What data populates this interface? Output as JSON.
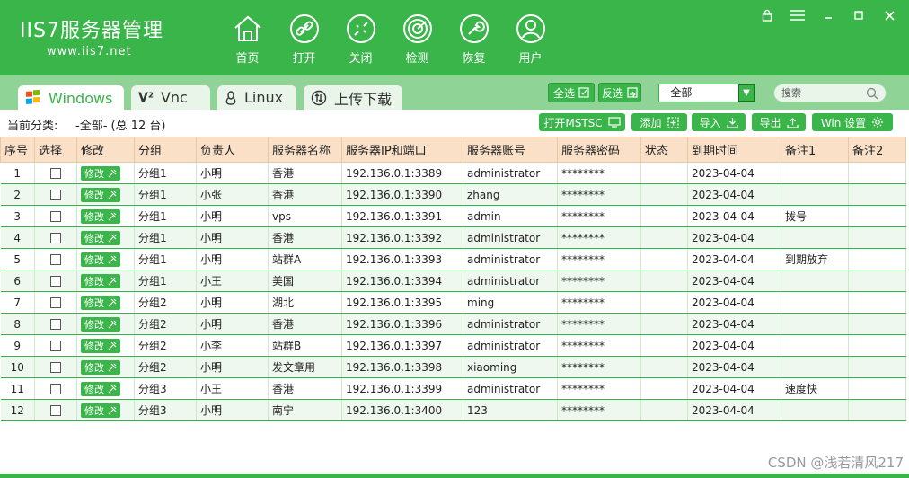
{
  "app": {
    "logo_title": "IIS7服务器管理",
    "logo_url": "www.iis7.net"
  },
  "nav": [
    {
      "label": "首页",
      "icon": "home-icon"
    },
    {
      "label": "打开",
      "icon": "link-icon"
    },
    {
      "label": "关闭",
      "icon": "unlink-icon"
    },
    {
      "label": "检测",
      "icon": "radar-icon"
    },
    {
      "label": "恢复",
      "icon": "wrench-icon"
    },
    {
      "label": "用户",
      "icon": "user-icon"
    }
  ],
  "tabs": [
    {
      "label": "Windows",
      "prefix": ""
    },
    {
      "label": "Vnc",
      "prefix": "V²"
    },
    {
      "label": "Linux",
      "prefix": ""
    },
    {
      "label": "上传下载",
      "prefix": ""
    }
  ],
  "tab_tools": {
    "select_all": "全选",
    "invert": "反选",
    "filter_value": "-全部-",
    "search_placeholder": "搜索"
  },
  "toolbar": {
    "category_label": "当前分类:",
    "category_value": "-全部- (总 12 台)",
    "open_mstsc": "打开MSTSC",
    "add": "添加",
    "import": "导入",
    "export": "导出",
    "win_settings": "Win 设置"
  },
  "table": {
    "headers": [
      "序号",
      "选择",
      "修改",
      "分组",
      "负责人",
      "服务器名称",
      "服务器IP和端口",
      "服务器账号",
      "服务器密码",
      "状态",
      "到期时间",
      "备注1",
      "备注2"
    ],
    "edit_label": "修改",
    "rows": [
      {
        "no": "1",
        "group": "分组1",
        "owner": "小明",
        "name": "香港",
        "ip": "192.136.0.1:3389",
        "account": "administrator",
        "password": "********",
        "status": "",
        "expire": "2023-04-04",
        "note1": "",
        "note2": ""
      },
      {
        "no": "2",
        "group": "分组1",
        "owner": "小张",
        "name": "香港",
        "ip": "192.136.0.1:3390",
        "account": "zhang",
        "password": "********",
        "status": "",
        "expire": "2023-04-04",
        "note1": "",
        "note2": ""
      },
      {
        "no": "3",
        "group": "分组1",
        "owner": "小明",
        "name": "vps",
        "ip": "192.136.0.1:3391",
        "account": "admin",
        "password": "********",
        "status": "",
        "expire": "2023-04-04",
        "note1": "拨号",
        "note2": ""
      },
      {
        "no": "4",
        "group": "分组1",
        "owner": "小明",
        "name": "香港",
        "ip": "192.136.0.1:3392",
        "account": "administrator",
        "password": "********",
        "status": "",
        "expire": "2023-04-04",
        "note1": "",
        "note2": ""
      },
      {
        "no": "5",
        "group": "分组1",
        "owner": "小明",
        "name": "站群A",
        "ip": "192.136.0.1:3393",
        "account": "administrator",
        "password": "********",
        "status": "",
        "expire": "2023-04-04",
        "note1": "到期放弃",
        "note2": ""
      },
      {
        "no": "6",
        "group": "分组1",
        "owner": "小王",
        "name": "美国",
        "ip": "192.136.0.1:3394",
        "account": "administrator",
        "password": "********",
        "status": "",
        "expire": "2023-04-04",
        "note1": "",
        "note2": ""
      },
      {
        "no": "7",
        "group": "分组2",
        "owner": "小明",
        "name": "湖北",
        "ip": "192.136.0.1:3395",
        "account": "ming",
        "password": "********",
        "status": "",
        "expire": "2023-04-04",
        "note1": "",
        "note2": ""
      },
      {
        "no": "8",
        "group": "分组2",
        "owner": "小明",
        "name": "香港",
        "ip": "192.136.0.1:3396",
        "account": "administrator",
        "password": "********",
        "status": "",
        "expire": "2023-04-04",
        "note1": "",
        "note2": ""
      },
      {
        "no": "9",
        "group": "分组2",
        "owner": "小李",
        "name": "站群B",
        "ip": "192.136.0.1:3397",
        "account": "administrator",
        "password": "********",
        "status": "",
        "expire": "2023-04-04",
        "note1": "",
        "note2": ""
      },
      {
        "no": "10",
        "group": "分组2",
        "owner": "小明",
        "name": "发文章用",
        "ip": "192.136.0.1:3398",
        "account": "xiaoming",
        "password": "********",
        "status": "",
        "expire": "2023-04-04",
        "note1": "",
        "note2": ""
      },
      {
        "no": "11",
        "group": "分组3",
        "owner": "小王",
        "name": "香港",
        "ip": "192.136.0.1:3399",
        "account": "administrator",
        "password": "********",
        "status": "",
        "expire": "2023-04-04",
        "note1": "速度快",
        "note2": ""
      },
      {
        "no": "12",
        "group": "分组3",
        "owner": "小明",
        "name": "南宁",
        "ip": "192.136.0.1:3400",
        "account": "123",
        "password": "********",
        "status": "",
        "expire": "2023-04-04",
        "note1": "",
        "note2": ""
      }
    ]
  },
  "watermark": "CSDN @浅若清风217",
  "colors": {
    "brand": "#3ab54a",
    "header_bg": "#f9e0c7",
    "row_alt": "#eef8ee"
  }
}
